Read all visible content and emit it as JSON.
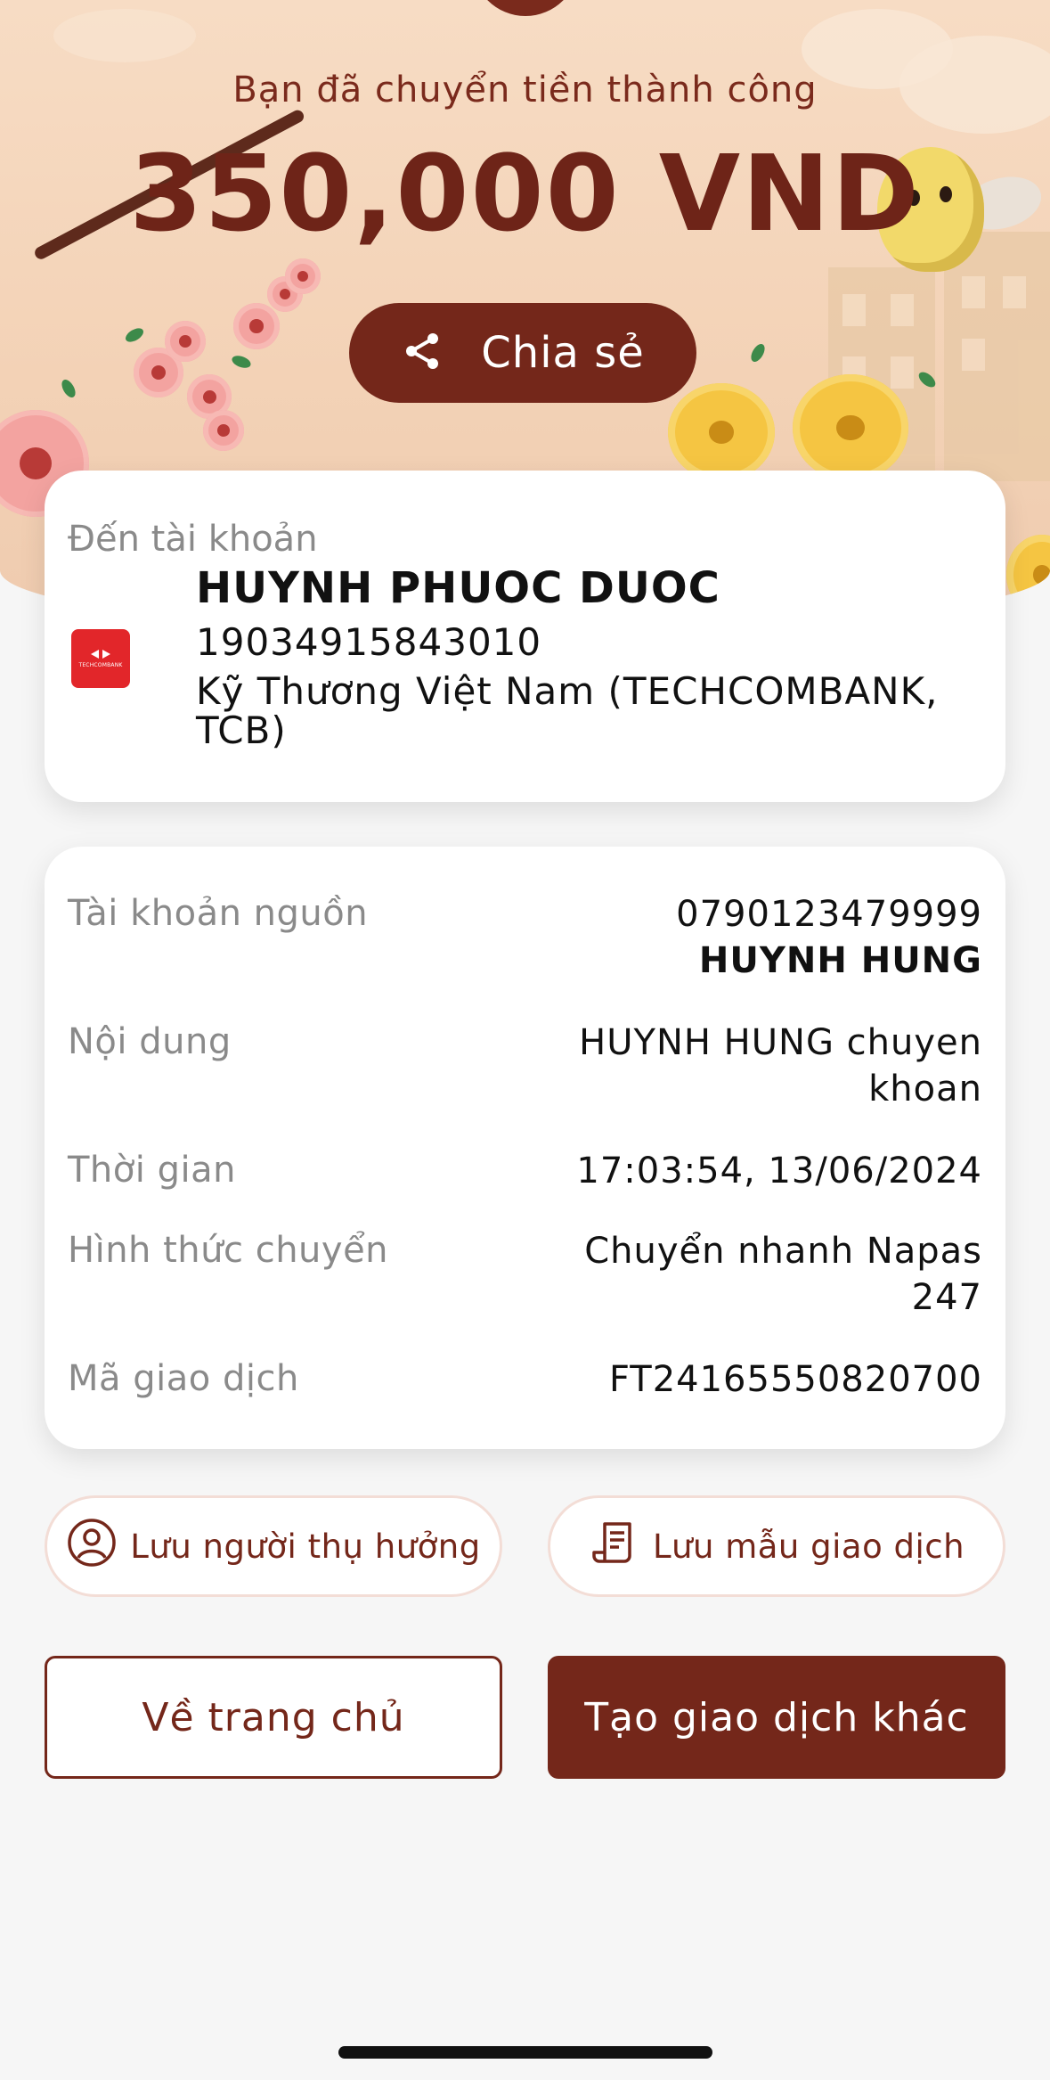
{
  "hero": {
    "subtitle": "Bạn đã chuyển tiền thành công",
    "amount": "350,000 VND",
    "share_label": "Chia sẻ"
  },
  "recipient": {
    "label": "Đến tài khoản",
    "name": "HUYNH PHUOC DUOC",
    "account": "19034915843010",
    "bank": "Kỹ Thương Việt Nam (TECHCOMBANK, TCB)",
    "bank_logo_text": "TECHCOMBANK",
    "bank_logo_color": "#e2262a"
  },
  "details": [
    {
      "label": "Tài khoản nguồn",
      "value": "0790123479999",
      "value2": "HUYNH HUNG"
    },
    {
      "label": "Nội dung",
      "value": "HUYNH HUNG chuyen",
      "value2": "khoan"
    },
    {
      "label": "Thời gian",
      "value": "17:03:54, 13/06/2024"
    },
    {
      "label": "Hình thức chuyển",
      "value": "Chuyển nhanh Napas",
      "value2": "247"
    },
    {
      "label": "Mã giao dịch",
      "value": "FT24165550820700"
    }
  ],
  "actions": {
    "save_beneficiary": "Lưu người thụ hưởng",
    "save_template": "Lưu mẫu giao dịch",
    "home": "Về trang chủ",
    "new_transaction": "Tạo giao dịch khác"
  },
  "colors": {
    "accent": "#74271a",
    "hero_bg": "#f3d2b6",
    "page_bg": "#f6f6f6"
  }
}
